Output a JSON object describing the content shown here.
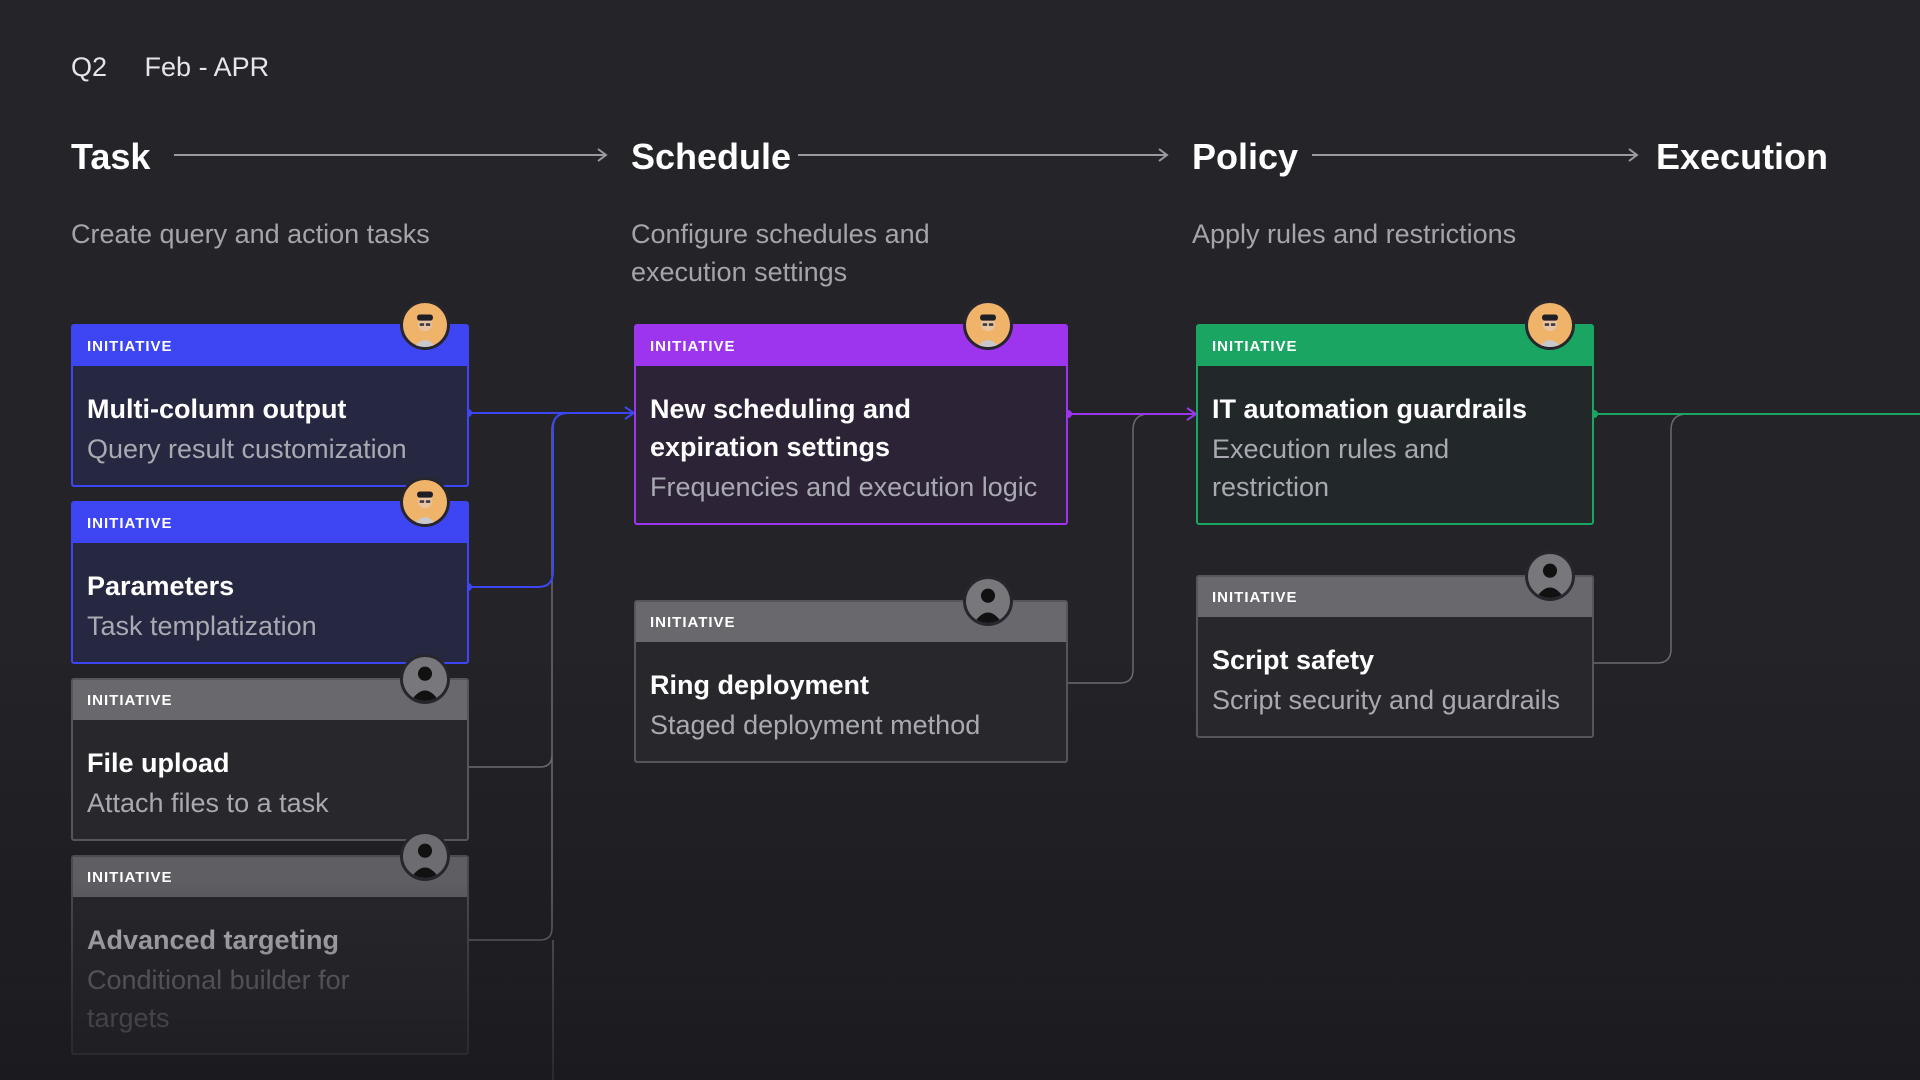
{
  "period": {
    "quarter": "Q2",
    "range": "Feb - APR"
  },
  "columns": [
    {
      "title": "Task",
      "subtitle": "Create query and action tasks"
    },
    {
      "title": "Schedule",
      "subtitle": "Configure schedules and execution settings"
    },
    {
      "title": "Policy",
      "subtitle": "Apply rules and restrictions"
    },
    {
      "title": "Execution",
      "subtitle": ""
    }
  ],
  "cards": [
    {
      "tag": "INITIATIVE",
      "title": "Multi-column output",
      "desc": "Query result customization",
      "status": "blue",
      "avatar": "person-photo-icon"
    },
    {
      "tag": "INITIATIVE",
      "title": "Parameters",
      "desc": "Task templatization",
      "status": "blue",
      "avatar": "person-photo-icon"
    },
    {
      "tag": "INITIATIVE",
      "title": "File upload",
      "desc": "Attach files to a task",
      "status": "gray",
      "avatar": "user-silhouette-icon"
    },
    {
      "tag": "INITIATIVE",
      "title": "Advanced targeting",
      "desc": "Conditional builder for targets",
      "status": "gray",
      "avatar": "user-silhouette-icon"
    },
    {
      "tag": "INITIATIVE",
      "title": "New scheduling and expiration settings",
      "desc": "Frequencies and execution logic",
      "status": "purple",
      "avatar": "person-photo-icon"
    },
    {
      "tag": "INITIATIVE",
      "title": "Ring deployment",
      "desc": "Staged deployment method",
      "status": "gray",
      "avatar": "user-silhouette-icon"
    },
    {
      "tag": "INITIATIVE",
      "title": "IT automation guardrails",
      "desc": "Execution rules and restriction",
      "status": "green",
      "avatar": "person-photo-icon"
    },
    {
      "tag": "INITIATIVE",
      "title": "Script safety",
      "desc": "Script security and guardrails",
      "status": "gray",
      "avatar": "user-silhouette-icon"
    }
  ],
  "colors": {
    "background": "#232329",
    "blue": "#3d46f2",
    "purple": "#9d34ee",
    "green": "#1aa562",
    "gray": "#6b6b70",
    "blue_card_bg": "#262740",
    "purple_card_bg": "#2c2336",
    "green_card_bg": "#22282a",
    "gray_card_bg": "#27272c"
  }
}
